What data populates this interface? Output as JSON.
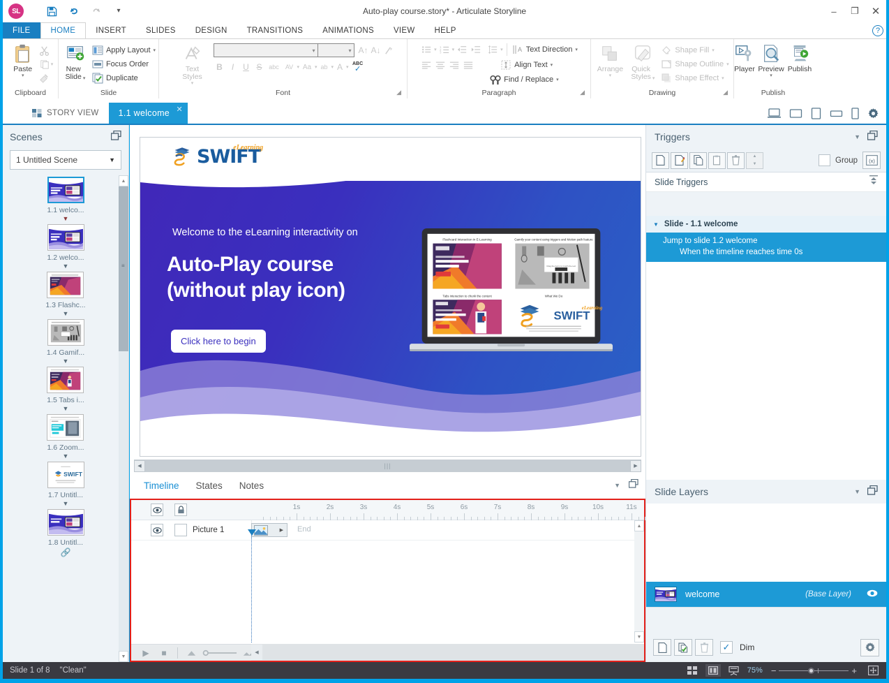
{
  "window": {
    "title": "Auto-play course.story* - Articulate Storyline",
    "app_logo": "SL",
    "quick_access": [
      {
        "name": "save-icon",
        "glyph": "💾"
      },
      {
        "name": "undo-icon",
        "glyph": "↶"
      },
      {
        "name": "redo-icon",
        "glyph": "↷"
      },
      {
        "name": "customize-qat-icon",
        "glyph": "▾"
      }
    ],
    "controls": {
      "minimize": "–",
      "maximize": "❐",
      "close": "✕",
      "help": "?"
    }
  },
  "ribbon": {
    "tabs": [
      "FILE",
      "HOME",
      "INSERT",
      "SLIDES",
      "DESIGN",
      "TRANSITIONS",
      "ANIMATIONS",
      "VIEW",
      "HELP"
    ],
    "active_tab": "HOME",
    "groups": {
      "clipboard": {
        "label": "Clipboard",
        "paste": "Paste",
        "cut": "Cut",
        "copy": "Copy",
        "format_painter": "Format Painter"
      },
      "slide": {
        "label": "Slide",
        "new_slide": "New\nSlide",
        "new_slide_l1": "New",
        "new_slide_l2": "Slide",
        "apply_layout": "Apply Layout",
        "focus_order": "Focus Order",
        "duplicate": "Duplicate"
      },
      "font": {
        "label": "Font",
        "text_styles": "Text Styles",
        "font_name": "",
        "font_size": "",
        "bold": "B",
        "italic": "I",
        "underline": "U",
        "strikethrough": "S",
        "small_caps": "abc",
        "character_spacing": "AV",
        "change_case": "Aa",
        "highlight": "ab",
        "font_color": "A",
        "spelling": "ABC"
      },
      "paragraph": {
        "label": "Paragraph",
        "text_direction": "Text Direction",
        "align_text": "Align Text",
        "find_replace": "Find / Replace"
      },
      "drawing": {
        "label": "Drawing",
        "arrange": "Arrange",
        "quick_styles_l1": "Quick",
        "quick_styles_l2": "Styles",
        "shape_fill": "Shape Fill",
        "shape_outline": "Shape Outline",
        "shape_effect": "Shape Effect"
      },
      "publish": {
        "label": "Publish",
        "player": "Player",
        "preview": "Preview",
        "publish": "Publish"
      }
    }
  },
  "view_bar": {
    "story_view": "STORY VIEW",
    "open_tab": "1.1 welcome",
    "close_glyph": "✕",
    "devices": [
      "desktop-icon",
      "tablet-landscape-icon",
      "tablet-portrait-icon",
      "phone-landscape-icon",
      "phone-portrait-icon",
      "settings-gear-icon"
    ]
  },
  "scenes": {
    "title": "Scenes",
    "scene_select": "1 Untitled Scene",
    "slides": [
      {
        "label": "1.1 welco...",
        "selected": true,
        "arrow": "red"
      },
      {
        "label": "1.2 welco...",
        "selected": false,
        "arrow": "grey"
      },
      {
        "label": "1.3 Flashc...",
        "selected": false,
        "arrow": "grey"
      },
      {
        "label": "1.4 Gamif...",
        "selected": false,
        "arrow": "grey"
      },
      {
        "label": "1.5 Tabs i...",
        "selected": false,
        "arrow": "grey"
      },
      {
        "label": "1.6 Zoom...",
        "selected": false,
        "arrow": "grey"
      },
      {
        "label": "1.7 Untitl...",
        "selected": false,
        "arrow": "grey"
      },
      {
        "label": "1.8 Untitl...",
        "selected": false,
        "arrow": "link"
      }
    ]
  },
  "slide": {
    "logo_text": "SWIFT",
    "logo_sup": "eLearning",
    "subtitle": "Welcome to the eLearning interactivity on",
    "title_line1": "Auto-Play course",
    "title_line2": "(without play icon)",
    "cta": "Click here to begin",
    "colors": {
      "bg_start": "#4127b8",
      "bg_end": "#2a62c6",
      "accent": "#f0a020",
      "logo_blue": "#1a5c9e"
    }
  },
  "timeline": {
    "tabs": [
      {
        "label": "Timeline",
        "active": true
      },
      {
        "label": "States",
        "active": false
      },
      {
        "label": "Notes",
        "active": false
      }
    ],
    "ruler_ticks": [
      "1s",
      "2s",
      "3s",
      "4s",
      "5s",
      "6s",
      "7s",
      "8s",
      "9s",
      "10s",
      "11s"
    ],
    "rows": [
      {
        "name": "Picture 1",
        "end_label": "End",
        "visible": true,
        "locked": false
      }
    ],
    "controls": {
      "play": "▶",
      "stop": "■",
      "collapse_all": "collapse-icon",
      "zoom_slider": "timeline-zoom-slider",
      "expand_all": "expand-icon"
    },
    "header_icons": {
      "eye": "eye-icon",
      "lock": "lock-icon"
    }
  },
  "triggers": {
    "title": "Triggers",
    "toolbar": [
      {
        "name": "new-trigger-button",
        "glyph": "new"
      },
      {
        "name": "edit-trigger-button",
        "glyph": "edit"
      },
      {
        "name": "copy-trigger-button",
        "glyph": "copy"
      },
      {
        "name": "paste-trigger-button",
        "glyph": "paste"
      },
      {
        "name": "delete-trigger-button",
        "glyph": "delete"
      }
    ],
    "group_label": "Group",
    "variables_button": "(x)",
    "section_title": "Slide Triggers",
    "slide_group": "Slide - 1.1 welcome",
    "items": [
      {
        "action": "Jump to slide 1.2 welcome",
        "condition": "When the timeline reaches time 0s",
        "selected": true
      }
    ]
  },
  "slide_layers": {
    "title": "Slide Layers",
    "layers": [
      {
        "name": "welcome",
        "badge": "(Base Layer)",
        "selected": true
      }
    ],
    "footer": {
      "new_layer": "new-layer-button",
      "duplicate_layer": "duplicate-layer-button",
      "delete_layer": "delete-layer-button",
      "dim_label": "Dim",
      "dim_checked": true,
      "settings": "layer-settings-button"
    }
  },
  "status_bar": {
    "slide_counter": "Slide 1 of 8",
    "theme": "\"Clean\"",
    "zoom_percent": "75%",
    "zoom_minus": "−",
    "zoom_plus": "+",
    "view_icons": [
      "normal-view-icon",
      "slide-view-icon",
      "presenter-view-icon"
    ],
    "fit_button": "fit-to-window-icon"
  }
}
